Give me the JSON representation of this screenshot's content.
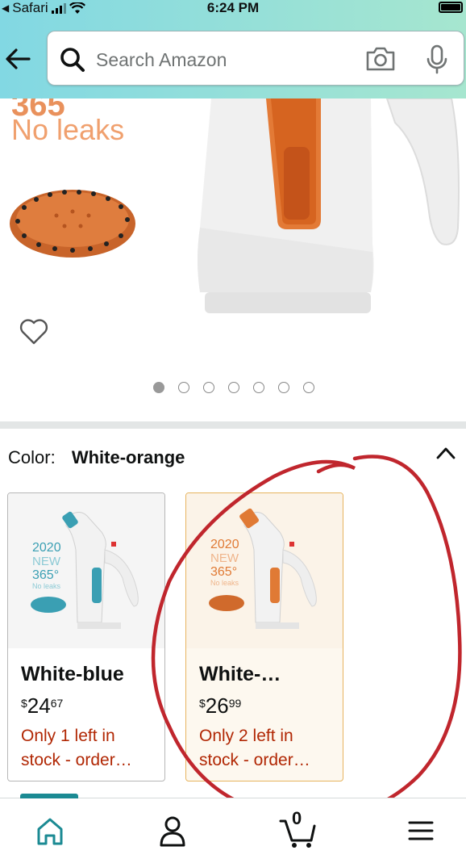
{
  "status_bar": {
    "carrier": "Safari",
    "time": "6:24 PM"
  },
  "search": {
    "placeholder": "Search Amazon"
  },
  "hero": {
    "brand_number": "365",
    "brand_tagline": "No leaks",
    "image_count": 7,
    "active_image": 1
  },
  "variation": {
    "label": "Color:",
    "selected": "White-orange"
  },
  "options": [
    {
      "name": "White-blue",
      "currency": "$",
      "price_whole": "24",
      "price_fraction": "67",
      "stock": "Only 1 left in stock - order…",
      "thumb_year": "2020",
      "thumb_new": "NEW",
      "thumb_num": "365°",
      "thumb_tag": "No leaks",
      "accent": "#3a9fb3"
    },
    {
      "name": "White-…",
      "currency": "$",
      "price_whole": "26",
      "price_fraction": "99",
      "stock": "Only 2 left in stock - order…",
      "thumb_year": "2020",
      "thumb_new": "NEW",
      "thumb_num": "365°",
      "thumb_tag": "No leaks",
      "accent": "#e07a35"
    }
  ],
  "tabbar": {
    "cart_count": "0",
    "icons": [
      "home-icon",
      "account-icon",
      "cart-icon",
      "menu-icon"
    ]
  },
  "colors": {
    "header_start": "#82d8e3",
    "header_end": "#a6e6cf",
    "stock_red": "#b12704",
    "selected_border": "#e7b45f",
    "annotation_red": "#c0262d",
    "tab_accent": "#1b8a93"
  }
}
